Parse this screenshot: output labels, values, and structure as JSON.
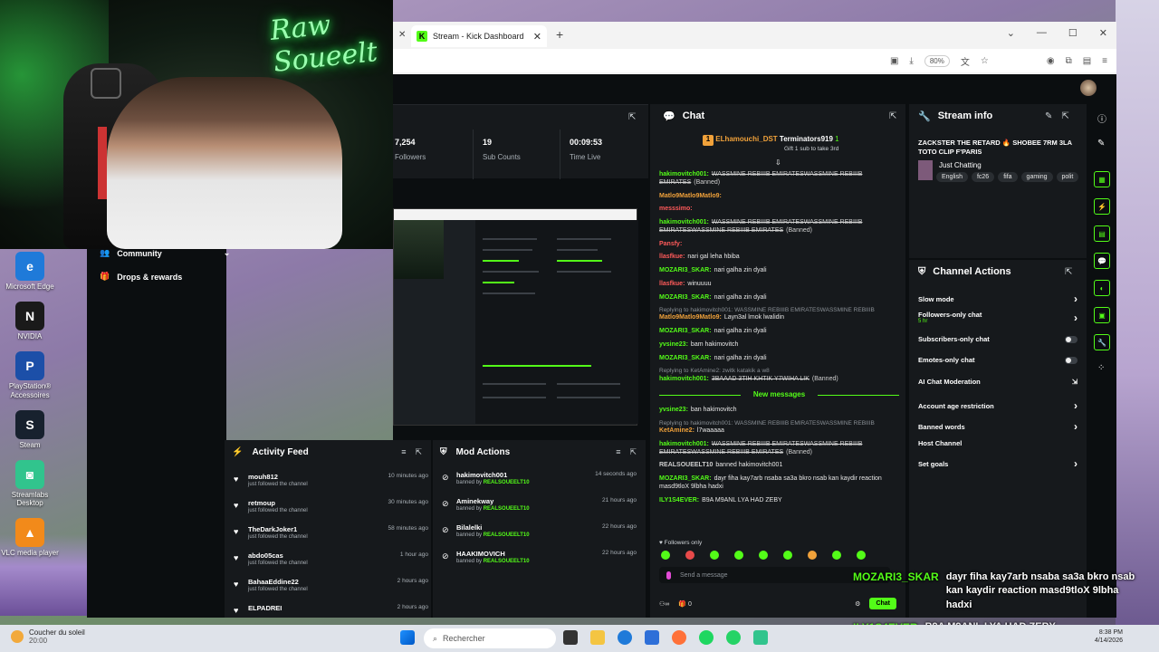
{
  "browser": {
    "tab_title": "Stream - Kick Dashboard",
    "zoom": "80%"
  },
  "webcam": {
    "neon_sign": "Raw Soueelt"
  },
  "desktop_icons": [
    {
      "label": "Microsoft Edge",
      "color": "#1f7ad9",
      "glyph": "e"
    },
    {
      "label": "NVIDIA",
      "color": "#1a1a1a",
      "glyph": "N"
    },
    {
      "label": "PlayStation® Accessoires",
      "color": "#1c4fa8",
      "glyph": "P"
    },
    {
      "label": "Steam",
      "color": "#17212e",
      "glyph": "S"
    },
    {
      "label": "Streamlabs Desktop",
      "color": "#31c48d",
      "glyph": "◙"
    },
    {
      "label": "VLC media player",
      "color": "#f28a1a",
      "glyph": "▲"
    }
  ],
  "leftnav": {
    "community": "Community",
    "drops": "Drops & rewards"
  },
  "stats": [
    {
      "value": "7,254",
      "label": "Followers"
    },
    {
      "value": "19",
      "label": "Sub Counts"
    },
    {
      "value": "00:09:53",
      "label": "Time Live"
    }
  ],
  "chat": {
    "title": "Chat",
    "pinned_user1": "ELhamouchi_DST",
    "pinned_user2": "Terminators919",
    "pinned_count": "1",
    "gift_text": "Gift 1 sub to take 3rd",
    "new_messages": "New messages",
    "followers_only": "Followers only",
    "send_placeholder": "Send a message",
    "counter": "0",
    "chat_button": "Chat",
    "messages": [
      {
        "user": "hakimovitch001:",
        "color": "#53fc18",
        "text": "WASSMINE REBIIIB EMIRATESWASSMINE REBIIIB EMIRATES",
        "tag": "(Banned)",
        "strike": true
      },
      {
        "user": "Matlo9Matlo9Matlo9:",
        "color": "#f0a13a",
        "text": "",
        "strike": false
      },
      {
        "user": "messsimo:",
        "color": "#ff5a5a",
        "text": "",
        "strike": false
      },
      {
        "user": "hakimovitch001:",
        "color": "#53fc18",
        "text": "WASSMINE REBIIIB EMIRATESWASSMINE REBIIIB EMIRATESWASSMINE REBIIIB EMIRATES",
        "tag": "(Banned)",
        "strike": true
      },
      {
        "user": "Pansfy:",
        "color": "#ff5a5a",
        "text": "",
        "strike": false
      },
      {
        "user": "llasfkue:",
        "color": "#ff5a5a",
        "text": "nari gal leha hbiba",
        "strike": false
      },
      {
        "user": "MOZARI3_SKAR:",
        "color": "#53fc18",
        "text": "nari galha zin dyali",
        "strike": false
      },
      {
        "user": "llasfkue:",
        "color": "#ff5a5a",
        "text": "winuuuu",
        "strike": false
      },
      {
        "user": "MOZARI3_SKAR:",
        "color": "#53fc18",
        "text": "nari galha zin dyali",
        "strike": false
      },
      {
        "reply": "Replying to hakimovitch001: WASSMINE REBIIIB EMIRATESWASSMINE REBIIIB",
        "user": "Matlo9Matlo9Matlo9:",
        "color": "#f0a13a",
        "text": "Layn3al lmok lwalidin",
        "strike": false
      },
      {
        "user": "MOZARI3_SKAR:",
        "color": "#53fc18",
        "text": "nari galha zin dyali",
        "strike": false
      },
      {
        "user": "yvsine23:",
        "color": "#53fc18",
        "text": "bam hakimovitch",
        "strike": false
      },
      {
        "user": "MOZARI3_SKAR:",
        "color": "#53fc18",
        "text": "nari galha zin dyali",
        "strike": false
      },
      {
        "reply": "Replying to KetAmine2: zwitk katakik a w8",
        "user": "hakimovitch001:",
        "color": "#53fc18",
        "text": "3BAAAD 3TIH KHTIK Y7WIHA LIK",
        "tag": "(Banned)",
        "strike": true
      }
    ],
    "messages_after": [
      {
        "user": "yvsine23:",
        "color": "#53fc18",
        "text": "ban hakimovitch",
        "strike": false
      },
      {
        "reply": "Replying to hakimovitch001: WASSMINE REBIIIB EMIRATESWASSMINE REBIIIB",
        "user": "KetAmine2:",
        "color": "#f0a13a",
        "text": "l7waaaaa",
        "strike": false
      },
      {
        "user": "hakimovitch001:",
        "color": "#53fc18",
        "text": "WASSMINE REBIIIB EMIRATESWASSMINE REBIIIB EMIRATESWASSMINE REBIIIB EMIRATES",
        "tag": "(Banned)",
        "strike": true
      },
      {
        "user": "REALSOUEELT10",
        "color": "#cfcfcf",
        "text": "banned hakimovitch001",
        "strike": false
      },
      {
        "user": "MOZARI3_SKAR:",
        "color": "#53fc18",
        "text": "dayr fiha kay7arb nsaba sa3a bkro nsab kan kaydir reaction masd9tloX 9lbha hadxi",
        "strike": false
      },
      {
        "user": "ILY1S4EVER:",
        "color": "#53fc18",
        "text": "B9A M9ANL LYA HAD ZEBY",
        "strike": false
      }
    ]
  },
  "stream_info": {
    "title": "Stream info",
    "stream_title": "ZACKSTER THE RETARD 🔥 SHOBEE 7RM 3LA TOTO CLIP F'PARIS",
    "category": "Just Chatting",
    "tags": [
      "English",
      "fc26",
      "fifa",
      "gaming",
      "polit"
    ]
  },
  "channel_actions": {
    "title": "Channel Actions",
    "items": [
      {
        "label": "Slow mode",
        "control": "chevron"
      },
      {
        "label": "Followers-only chat",
        "sub": "5 hr",
        "control": "chevron"
      },
      {
        "label": "Subscribers-only chat",
        "control": "toggle"
      },
      {
        "label": "Emotes-only chat",
        "control": "toggle"
      },
      {
        "label": "AI Chat Moderation",
        "control": "external"
      },
      {
        "label": "Account age restriction",
        "control": "chevron"
      },
      {
        "label": "Banned words",
        "control": "chevron"
      },
      {
        "label": "Host Channel",
        "control": "none"
      },
      {
        "label": "Set goals",
        "control": "chevron"
      }
    ]
  },
  "activity_feed": {
    "title": "Activity Feed",
    "items": [
      {
        "name": "mouh812",
        "sub": "just followed the channel",
        "time": "10 minutes ago"
      },
      {
        "name": "retmoup",
        "sub": "just followed the channel",
        "time": "30 minutes ago"
      },
      {
        "name": "TheDarkJoker1",
        "sub": "just followed the channel",
        "time": "58 minutes ago"
      },
      {
        "name": "abdo05cas",
        "sub": "just followed the channel",
        "time": "1 hour ago"
      },
      {
        "name": "BahaaEddine22",
        "sub": "just followed the channel",
        "time": "2 hours ago"
      },
      {
        "name": "ELPADREI",
        "sub": "",
        "time": "2 hours ago"
      }
    ]
  },
  "mod_actions": {
    "title": "Mod Actions",
    "items": [
      {
        "name": "hakimovitch001",
        "by": "REALSOUEELT10",
        "time": "14 seconds ago"
      },
      {
        "name": "Aminekway",
        "by": "REALSOUEELT10",
        "time": "21 hours ago"
      },
      {
        "name": "Bilalelki",
        "by": "REALSOUEELT10",
        "time": "22 hours ago"
      },
      {
        "name": "HAAKIMOVICH",
        "by": "REALSOUEELT10",
        "time": "22 hours ago"
      }
    ],
    "banned_by": "banned by"
  },
  "overlay": {
    "user1": "MOZARI3_SKAR",
    "text1": "dayr fiha kay7arb nsaba sa3a bkro nsab kan kaydir reaction masd9tloX 9lbha hadxi",
    "user2": "ILY1S4EVER",
    "text2": "B9A M9ANL LYA HAD ZEBY"
  },
  "taskbar": {
    "weather_title": "Coucher du soleil",
    "weather_time": "20:00",
    "search": "Rechercher",
    "time": "8:38 PM",
    "date": "4/14/2026"
  }
}
